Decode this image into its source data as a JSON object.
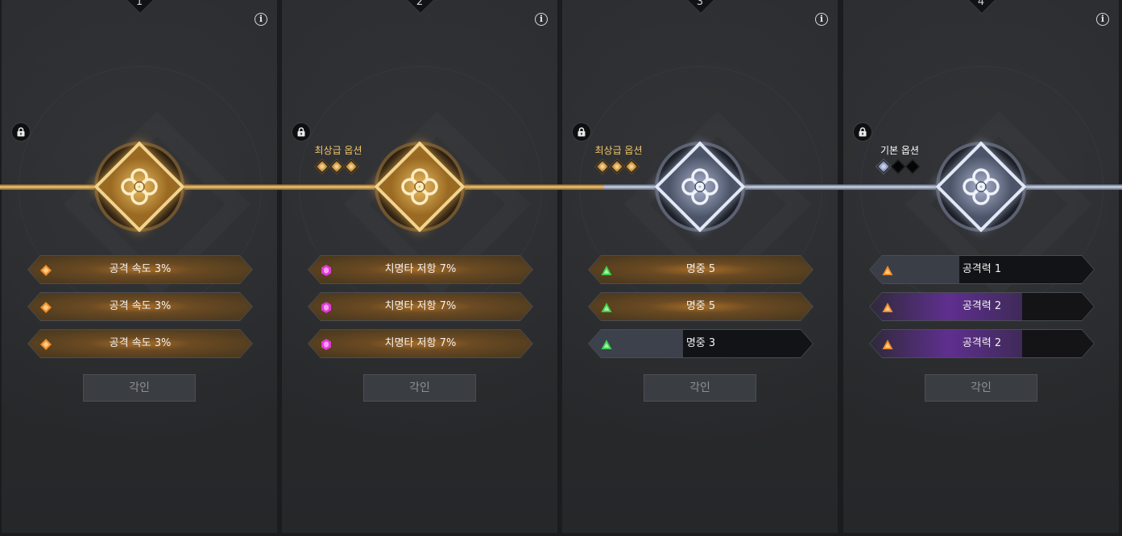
{
  "panels": [
    {
      "number": "1",
      "grade_label": "",
      "grade_pips": [],
      "emblem": "gold",
      "options": [
        {
          "text": "공격 속도 3%",
          "style": "gold",
          "icon": "orange-diamond-icon"
        },
        {
          "text": "공격 속도 3%",
          "style": "gold",
          "icon": "orange-diamond-icon"
        },
        {
          "text": "공격 속도 3%",
          "style": "gold",
          "icon": "orange-diamond-icon"
        }
      ],
      "button": "각인"
    },
    {
      "number": "2",
      "grade_label": "최상급 옵션",
      "grade_pips": [
        "gold",
        "gold",
        "gold"
      ],
      "emblem": "gold",
      "options": [
        {
          "text": "치명타 저항 7%",
          "style": "gold",
          "icon": "magenta-hexagon-icon"
        },
        {
          "text": "치명타 저항 7%",
          "style": "gold",
          "icon": "magenta-hexagon-icon"
        },
        {
          "text": "치명타 저항 7%",
          "style": "gold",
          "icon": "magenta-hexagon-icon"
        }
      ],
      "button": "각인"
    },
    {
      "number": "3",
      "grade_label": "최상급 옵션",
      "grade_pips": [
        "gold",
        "gold",
        "gold"
      ],
      "emblem": "silver",
      "options": [
        {
          "text": "명중 5",
          "style": "gold",
          "icon": "green-triangle-icon"
        },
        {
          "text": "명중 5",
          "style": "gold",
          "icon": "green-triangle-icon"
        },
        {
          "text": "명중 3",
          "style": "partial",
          "icon": "green-triangle-icon"
        }
      ],
      "button": "각인"
    },
    {
      "number": "4",
      "grade_label": "기본 옵션",
      "grade_pips": [
        "silver",
        "dark",
        "dark"
      ],
      "emblem": "silver",
      "options": [
        {
          "text": "공격력 1",
          "style": "dark",
          "icon": "orange-triangle-icon"
        },
        {
          "text": "공격력 2",
          "style": "purple",
          "icon": "orange-triangle-icon"
        },
        {
          "text": "공격력 2",
          "style": "purple",
          "icon": "orange-triangle-icon"
        }
      ],
      "button": "각인"
    }
  ],
  "colors": {
    "gold_accent": "#f0c76a",
    "silver_accent": "#cfd7ea",
    "purple_accent": "#5f2f8f",
    "green_icon": "#3fcf4a",
    "magenta_icon": "#e03ad6",
    "orange_icon": "#f08c2a"
  }
}
